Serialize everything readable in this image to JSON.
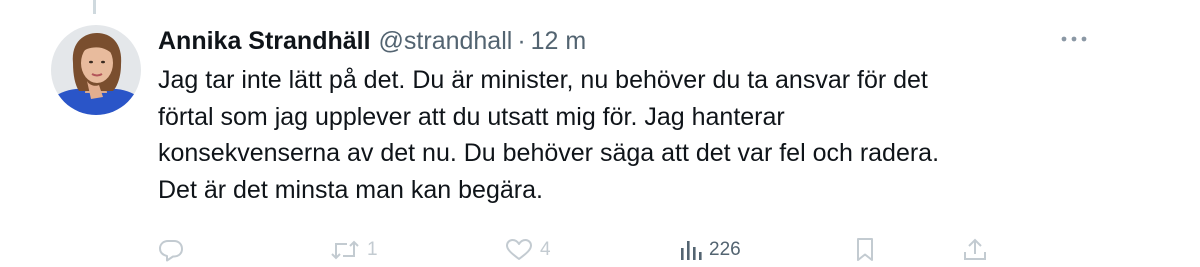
{
  "tweet": {
    "author": {
      "display_name": "Annika Strandhäll",
      "handle": "@strandhall",
      "avatar_icon": "profile-photo"
    },
    "separator": "·",
    "timestamp": "12 m",
    "more_icon": "more-horizontal-icon",
    "text_lines": [
      "Jag tar inte lätt på det. Du är minister, nu behöver du ta ansvar för det",
      "förtal som jag upplever att du utsatt mig för. Jag hanterar",
      "konsekvenserna av det nu. Du behöver säga att det var fel och radera.",
      "Det är det minsta man kan begära."
    ],
    "actions": {
      "reply": {
        "icon": "reply-icon",
        "count": ""
      },
      "retweet": {
        "icon": "retweet-icon",
        "count": "1"
      },
      "like": {
        "icon": "heart-icon",
        "count": "4"
      },
      "views": {
        "icon": "views-bar-chart-icon",
        "count": "226"
      },
      "bookmark": {
        "icon": "bookmark-icon",
        "count": ""
      },
      "share": {
        "icon": "share-icon",
        "count": ""
      }
    }
  },
  "colors": {
    "text_primary": "#0f1419",
    "text_secondary": "#536471",
    "action_faded": "#c3cbd1",
    "thread_line": "#cfd9de",
    "background": "#ffffff"
  }
}
